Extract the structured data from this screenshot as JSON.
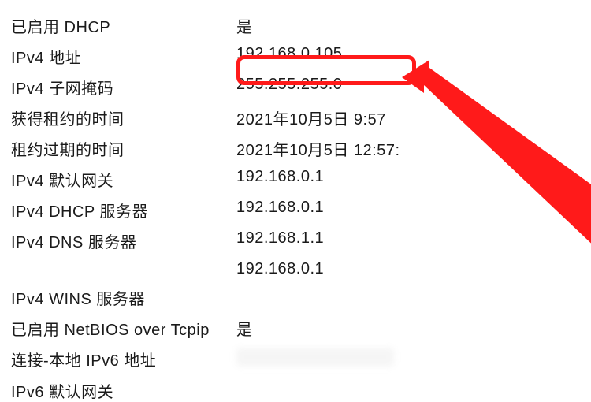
{
  "properties": [
    {
      "label": "已启用 DHCP",
      "value": "是"
    },
    {
      "label": "IPv4 地址",
      "value": "192.168.0.105"
    },
    {
      "label": "IPv4 子网掩码",
      "value": "255.255.255.0"
    },
    {
      "label": "获得租约的时间",
      "value": "2021年10月5日 9:57"
    },
    {
      "label": "租约过期的时间",
      "value": "2021年10月5日 12:57:"
    },
    {
      "label": "IPv4 默认网关",
      "value": "192.168.0.1"
    },
    {
      "label": "IPv4 DHCP 服务器",
      "value": "192.168.0.1"
    },
    {
      "label": "IPv4 DNS 服务器",
      "value": "192.168.1.1"
    },
    {
      "label": "",
      "value": "192.168.0.1"
    },
    {
      "label": "IPv4 WINS 服务器",
      "value": ""
    },
    {
      "label": "已启用 NetBIOS over Tcpip",
      "value": "是"
    },
    {
      "label": "连接-本地 IPv6 地址",
      "value": ""
    },
    {
      "label": "IPv6 默认网关",
      "value": ""
    }
  ],
  "annotations": {
    "highlight_color": "#ff1a1a"
  }
}
